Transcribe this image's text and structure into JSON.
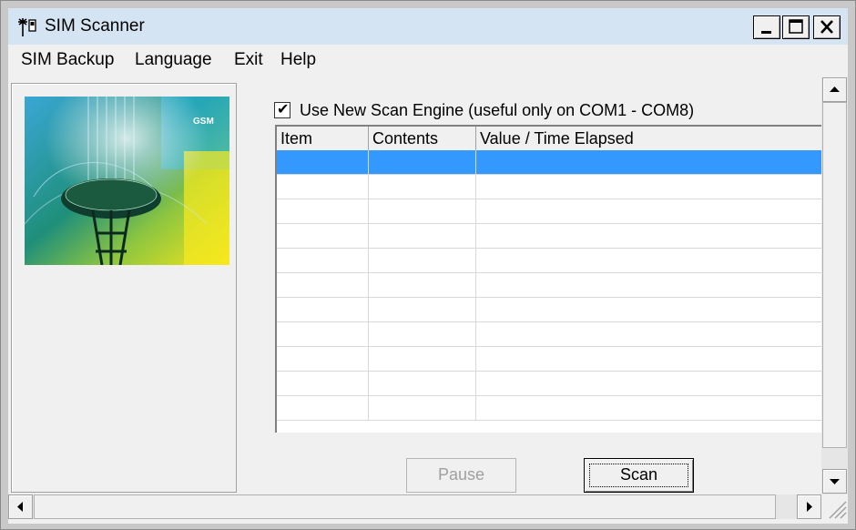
{
  "window": {
    "title": "SIM Scanner"
  },
  "menu": {
    "items": [
      "SIM Backup",
      "Language",
      "Exit",
      "Help"
    ]
  },
  "options": {
    "use_new_scan_engine": {
      "label": "Use New Scan Engine (useful only on COM1 - COM8)",
      "checked": true
    }
  },
  "image": {
    "badge": "GSM"
  },
  "table": {
    "columns": [
      "Item",
      "Contents",
      "Value / Time Elapsed"
    ],
    "rows": [
      [
        "",
        "",
        ""
      ],
      [
        "",
        "",
        ""
      ],
      [
        "",
        "",
        ""
      ],
      [
        "",
        "",
        ""
      ],
      [
        "",
        "",
        ""
      ],
      [
        "",
        "",
        ""
      ],
      [
        "",
        "",
        ""
      ],
      [
        "",
        "",
        ""
      ],
      [
        "",
        "",
        ""
      ],
      [
        "",
        "",
        ""
      ],
      [
        "",
        "",
        ""
      ]
    ],
    "selected_row": 0
  },
  "buttons": {
    "pause": "Pause",
    "scan": "Scan"
  },
  "colors": {
    "title_bar": "#d5e4f3",
    "selection": "#3399ff",
    "face": "#f0f0f0"
  }
}
